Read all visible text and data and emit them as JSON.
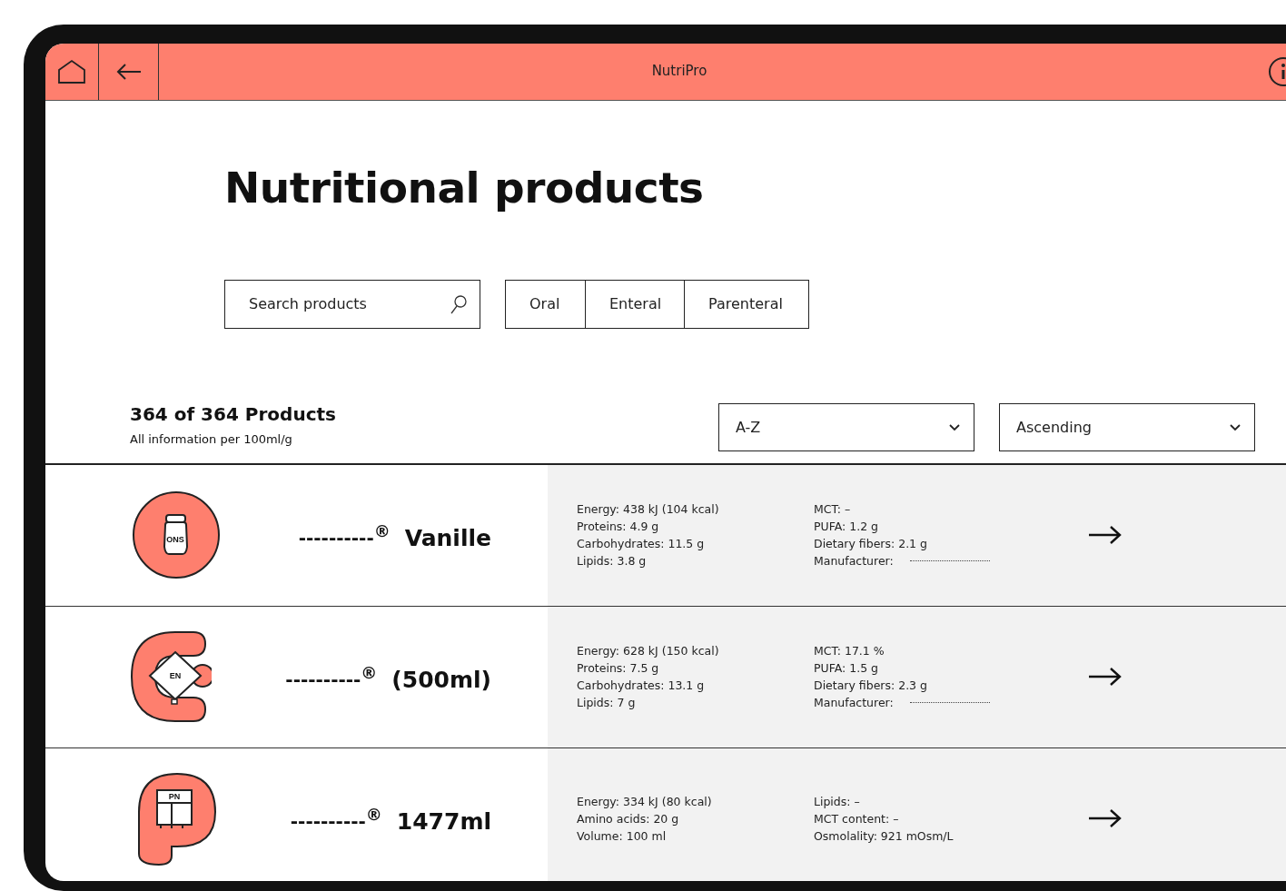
{
  "header": {
    "title": "NutriPro"
  },
  "page_title": "Nutritional products",
  "search": {
    "placeholder": "Search products"
  },
  "filters": [
    {
      "label": "Oral",
      "selected": false
    },
    {
      "label": "Enteral",
      "selected": false
    },
    {
      "label": "Parenteral",
      "selected": false
    }
  ],
  "summary": {
    "count": "364 of 364 Products",
    "note": "All information per 100ml/g"
  },
  "sort": [
    {
      "value": "A-Z"
    },
    {
      "value": "Ascending"
    }
  ],
  "products": [
    {
      "kind": "oral",
      "badge": "ONS",
      "brand": "----------$^{®}$",
      "name": "Vanille",
      "stats_1": [
        {
          "text": "Energy: 438 kJ (104 kcal)"
        },
        {
          "text": "Proteins: 4.9 g"
        },
        {
          "text": "Carbohydrates: 11.5 g"
        },
        {
          "text": "Lipids: 3.8 g"
        }
      ],
      "stats_2": [
        {
          "text": "MCT: –"
        },
        {
          "text": "PUFA: 1.2 g"
        },
        {
          "text": "Dietary fibers: 2.1 g"
        },
        {
          "text": "Manufacturer:",
          "blank": true
        }
      ]
    },
    {
      "kind": "enteral",
      "badge": "EN",
      "brand": "----------$^{®}$",
      "name": "(500ml)",
      "stats_1": [
        {
          "text": "Energy: 628 kJ (150 kcal)"
        },
        {
          "text": "Proteins: 7.5 g"
        },
        {
          "text": "Carbohydrates: 13.1 g"
        },
        {
          "text": "Lipids: 7 g"
        }
      ],
      "stats_2": [
        {
          "text": "MCT: 17.1 %"
        },
        {
          "text": "PUFA: 1.5 g"
        },
        {
          "text": "Dietary fibers: 2.3 g"
        },
        {
          "text": "Manufacturer:",
          "blank": true
        }
      ]
    },
    {
      "kind": "parenteral",
      "badge": "PN",
      "brand": "----------$^{®}$",
      "name": "1477ml",
      "stats_1": [
        {
          "text": "Energy: 334 kJ (80 kcal)"
        },
        {
          "text": "Amino acids: 20 g"
        },
        {
          "text": "Volume: 100 ml"
        }
      ],
      "stats_2": [
        {
          "text": "Lipids: –"
        },
        {
          "text": "MCT content: –"
        },
        {
          "text": "Osmolality: 921 mOsm/L"
        }
      ]
    }
  ]
}
